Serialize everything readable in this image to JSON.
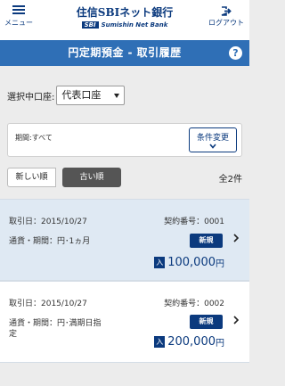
{
  "header": {
    "menu_label": "メニュー",
    "logo_main": "住信SBIネット銀行",
    "logo_sbi": "SBI",
    "logo_sub": "Sumishin Net Bank",
    "logout_label": "ログアウト",
    "brand_color": "#0b3a7e"
  },
  "titlebar": {
    "title": "円定期預金 - 取引履歴",
    "help": "?",
    "color": "#2f6fb6"
  },
  "account": {
    "label": "選択中口座:",
    "selected": "代表口座"
  },
  "filter": {
    "period_text": "期間:すべて",
    "button_label": "条件変更"
  },
  "sort": {
    "newest_label": "新しい順",
    "oldest_label": "古い順",
    "selected": "古い順"
  },
  "total": "全2件",
  "transactions": [
    {
      "date": "取引日：2015/10/27",
      "contract": "契約番号：0001",
      "currency_period": "通貨・期間：円･1ヵ月",
      "status": "新規",
      "in_badge": "入",
      "amount": "100,000",
      "unit": "円"
    },
    {
      "date": "取引日：2015/10/27",
      "contract": "契約番号：0002",
      "currency_period": "通貨・期間：円･満期日指定",
      "status": "新規",
      "in_badge": "入",
      "amount": "200,000",
      "unit": "円"
    }
  ]
}
